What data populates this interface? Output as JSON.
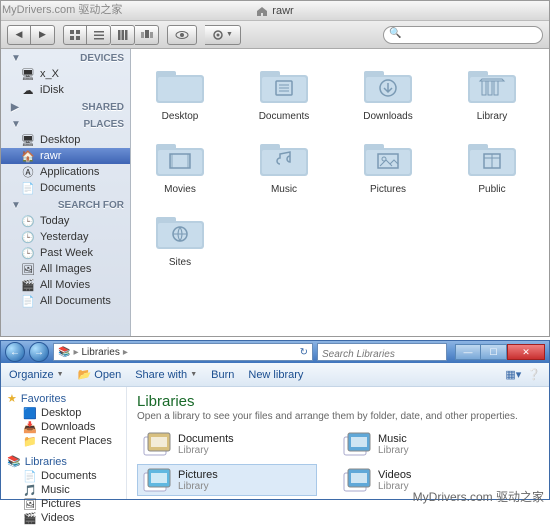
{
  "watermark": {
    "tl": "MyDrivers.com 驱动之家",
    "br": "MyDrivers.com 驱动之家"
  },
  "mac": {
    "title": "rawr",
    "search_placeholder": "",
    "sidebar": {
      "devices": {
        "head": "DEVICES",
        "items": [
          {
            "label": "x_X",
            "icon": "imac-icon"
          },
          {
            "label": "iDisk",
            "icon": "idisk-icon"
          }
        ]
      },
      "shared": {
        "head": "SHARED"
      },
      "places": {
        "head": "PLACES",
        "items": [
          {
            "label": "Desktop",
            "icon": "desktop-icon"
          },
          {
            "label": "rawr",
            "icon": "home-icon",
            "selected": true
          },
          {
            "label": "Applications",
            "icon": "apps-icon"
          },
          {
            "label": "Documents",
            "icon": "documents-icon"
          }
        ]
      },
      "search_for": {
        "head": "SEARCH FOR",
        "items": [
          {
            "label": "Today",
            "icon": "clock-icon"
          },
          {
            "label": "Yesterday",
            "icon": "clock-icon"
          },
          {
            "label": "Past Week",
            "icon": "clock-icon"
          },
          {
            "label": "All Images",
            "icon": "image-icon"
          },
          {
            "label": "All Movies",
            "icon": "movie-icon"
          },
          {
            "label": "All Documents",
            "icon": "document-icon"
          }
        ]
      }
    },
    "folders": [
      {
        "label": "Desktop",
        "glyph": "desktop"
      },
      {
        "label": "Documents",
        "glyph": "documents"
      },
      {
        "label": "Downloads",
        "glyph": "downloads"
      },
      {
        "label": "Library",
        "glyph": "library"
      },
      {
        "label": "Movies",
        "glyph": "movies"
      },
      {
        "label": "Music",
        "glyph": "music"
      },
      {
        "label": "Pictures",
        "glyph": "pictures"
      },
      {
        "label": "Public",
        "glyph": "public"
      },
      {
        "label": "Sites",
        "glyph": "sites"
      }
    ]
  },
  "win": {
    "breadcrumb": {
      "root_icon": "libraries-icon",
      "label": "Libraries"
    },
    "search_placeholder": "Search Libraries",
    "toolbar": {
      "organize": "Organize",
      "open": "Open",
      "share": "Share with",
      "burn": "Burn",
      "newlib": "New library"
    },
    "sidebar": {
      "favorites": {
        "head": "Favorites",
        "items": [
          {
            "label": "Desktop",
            "icon": "desktop-icon"
          },
          {
            "label": "Downloads",
            "icon": "downloads-icon"
          },
          {
            "label": "Recent Places",
            "icon": "recent-icon"
          }
        ]
      },
      "libraries": {
        "head": "Libraries",
        "items": [
          {
            "label": "Documents",
            "icon": "documents-icon"
          },
          {
            "label": "Music",
            "icon": "music-icon"
          },
          {
            "label": "Pictures",
            "icon": "pictures-icon"
          },
          {
            "label": "Videos",
            "icon": "videos-icon"
          }
        ]
      }
    },
    "content": {
      "title": "Libraries",
      "subtitle": "Open a library to see your files and arrange them by folder, date, and other properties.",
      "lib_sublabel": "Library",
      "libs": [
        {
          "label": "Documents",
          "icon": "documents-lib-icon"
        },
        {
          "label": "Music",
          "icon": "music-lib-icon"
        },
        {
          "label": "Pictures",
          "icon": "pictures-lib-icon",
          "selected": true
        },
        {
          "label": "Videos",
          "icon": "videos-lib-icon"
        }
      ]
    }
  }
}
